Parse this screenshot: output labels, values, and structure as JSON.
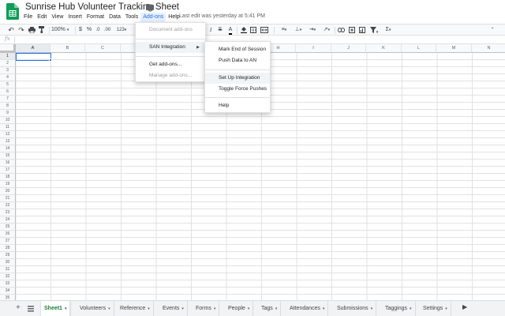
{
  "header": {
    "title": "Sunrise Hub Volunteer Tracking Sheet",
    "last_edit": "Last edit was yesterday at 5:41 PM"
  },
  "menubar": {
    "items": [
      "File",
      "Edit",
      "View",
      "Insert",
      "Format",
      "Data",
      "Tools",
      "Add-ons",
      "Help"
    ],
    "active": "Add-ons"
  },
  "toolbar": {
    "zoom": "100%",
    "currency": "$",
    "percent": "%",
    "decimal_dec": ".0",
    "decimal_inc": ".00",
    "more_formats": "123"
  },
  "grid": {
    "columns": [
      "A",
      "B",
      "C",
      "D",
      "E",
      "F",
      "G",
      "H",
      "I",
      "J",
      "K",
      "L",
      "M",
      "N"
    ],
    "rows": [
      "1",
      "2",
      "3",
      "4",
      "5",
      "6",
      "7",
      "8",
      "9",
      "10",
      "11",
      "12",
      "13",
      "14",
      "15",
      "16",
      "17",
      "18",
      "19",
      "20",
      "21",
      "22",
      "23",
      "24",
      "25",
      "26",
      "27",
      "28",
      "29",
      "30",
      "31",
      "32",
      "33",
      "34",
      "35"
    ],
    "active_cell": "A1"
  },
  "addons_menu": {
    "items": [
      {
        "label": "Document add-ons",
        "disabled": true
      },
      {
        "label": "SAN Integration",
        "submenu": true
      },
      {
        "label": "Get add-ons..."
      },
      {
        "label": "Manage add-ons...",
        "disabled": true
      }
    ]
  },
  "san_submenu": {
    "items": [
      "Mark End of Session",
      "Push Data to AN",
      "Set Up Integration",
      "Toggle Force Pushes",
      "Help"
    ],
    "hovered": "Set Up Integration"
  },
  "sheet_tabs": {
    "tabs": [
      "Sheet1",
      "Volunteers",
      "Reference",
      "Events",
      "Forms",
      "People",
      "Tags",
      "Attendances",
      "Submissions",
      "Taggings",
      "Settings"
    ],
    "active": "Sheet1"
  },
  "colors": {
    "accent": "#1a73e8",
    "sheets_green": "#0f9d58",
    "active_tab_text": "#188038"
  }
}
